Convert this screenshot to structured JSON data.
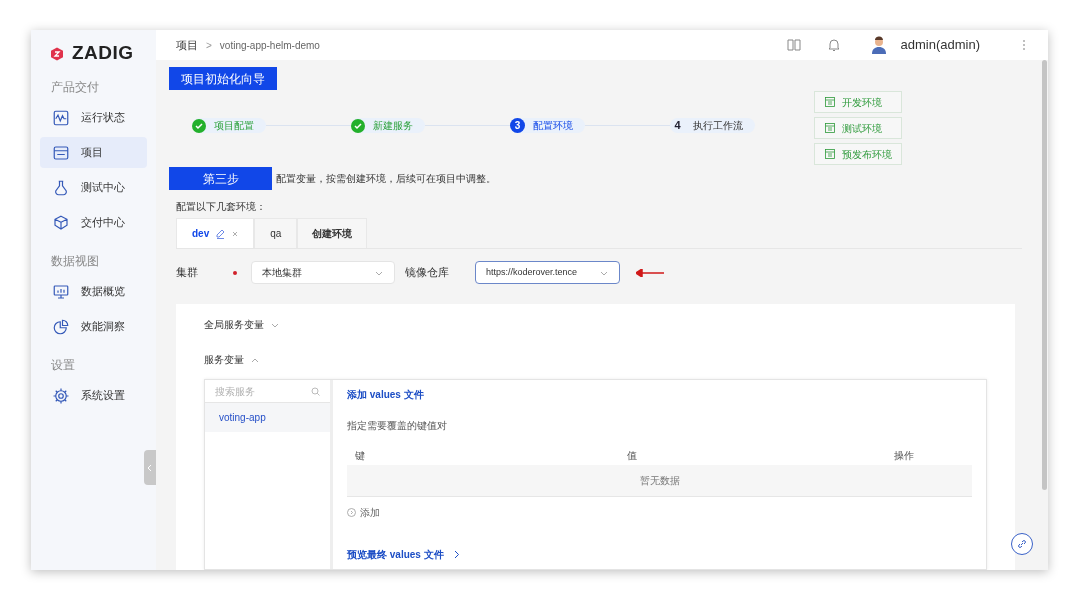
{
  "logo": "ZADIG",
  "sidebar": {
    "sections": [
      {
        "title": "产品交付",
        "items": [
          {
            "label": "运行状态",
            "selected": false
          },
          {
            "label": "项目",
            "selected": true
          },
          {
            "label": "测试中心",
            "selected": false
          },
          {
            "label": "交付中心",
            "selected": false
          }
        ]
      },
      {
        "title": "数据视图",
        "items": [
          {
            "label": "数据概览",
            "selected": false
          },
          {
            "label": "效能洞察",
            "selected": false
          }
        ]
      },
      {
        "title": "设置",
        "items": [
          {
            "label": "系统设置",
            "selected": false
          }
        ]
      }
    ]
  },
  "breadcrumb": {
    "items": [
      "项目",
      "voting-app-helm-demo"
    ],
    "separator": ">"
  },
  "user": {
    "name": "admin(admin)"
  },
  "wizard_button": "项目初始化向导",
  "steps": [
    {
      "label": "项目配置",
      "done": true,
      "selected": false
    },
    {
      "label": "新建服务",
      "done": true,
      "selected": false
    },
    {
      "number": "3",
      "label": "配置环境",
      "done": false,
      "selected": true
    },
    {
      "number": "4",
      "label": "执行工作流",
      "done": false,
      "selected": false
    }
  ],
  "env_buttons": [
    "开发环境",
    "测试环境",
    "预发布环境"
  ],
  "step_badge": "第三步",
  "step_description": "配置变量，按需创建环境，后续可在项目中调整。",
  "env_label": "配置以下几套环境：",
  "env_tabs": [
    {
      "kind": "env",
      "label": "dev",
      "selected": true
    },
    {
      "kind": "env",
      "label": "qa",
      "selected": false
    },
    {
      "kind": "create",
      "label": "创建环境",
      "selected": false
    }
  ],
  "cluster": {
    "label": "集群",
    "required": true,
    "value": "本地集群"
  },
  "registry": {
    "label": "镜像仓库",
    "value": "https://koderover.tence"
  },
  "global_vars": {
    "label": "全局服务变量",
    "expanded": false
  },
  "service_vars": {
    "label": "服务变量",
    "expanded": true
  },
  "service_search": {
    "placeholder": "搜索服务"
  },
  "services": [
    {
      "name": "voting-app",
      "selected": true
    }
  ],
  "add_values_link": "添加 values 文件",
  "kv_hint": "指定需要覆盖的键值对",
  "table": {
    "columns": [
      "键",
      "值",
      "操作"
    ],
    "empty": "暂无数据"
  },
  "add_button": "添加",
  "preview_link": "预览最终 values 文件"
}
